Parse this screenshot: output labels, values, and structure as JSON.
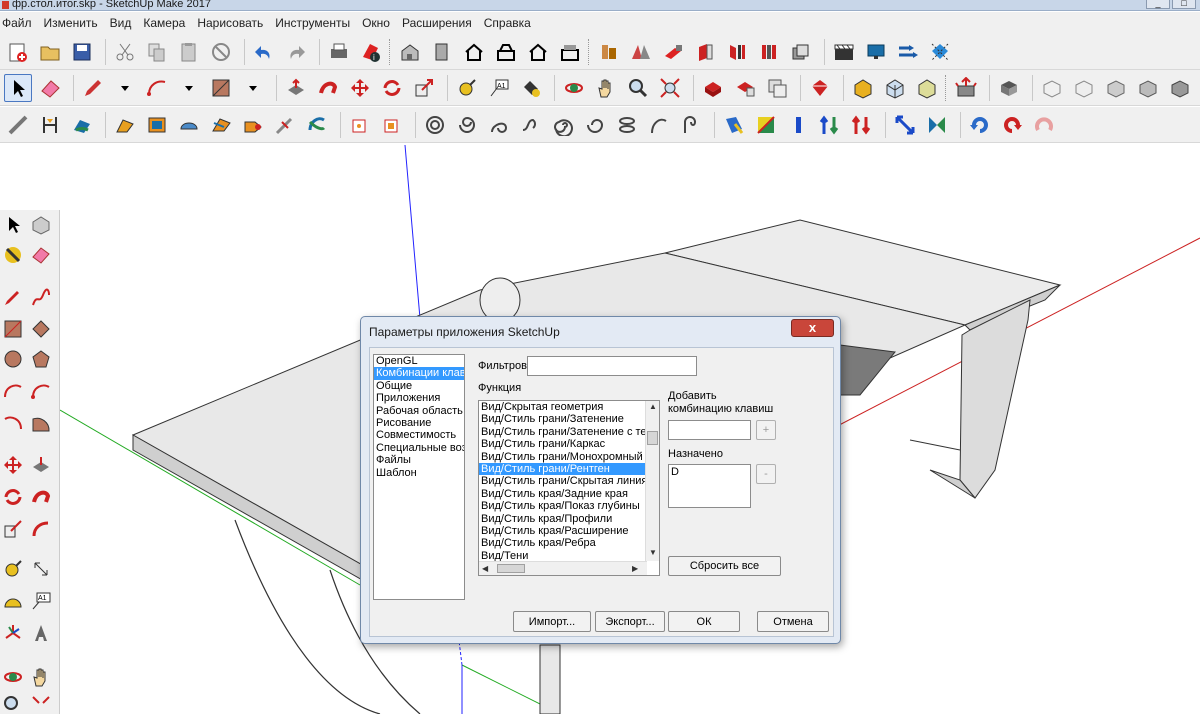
{
  "window": {
    "title": "фр.стол.итог.skp - SketchUp Make 2017",
    "minimize": "_",
    "maximize": "□"
  },
  "menu": [
    "Файл",
    "Изменить",
    "Вид",
    "Камера",
    "Нарисовать",
    "Инструменты",
    "Окно",
    "Расширения",
    "Справка"
  ],
  "toolbar_icons": {
    "row1": [
      "new-file-icon",
      "open-folder-icon",
      "save-icon",
      "cut-icon",
      "copy-icon",
      "paste-icon",
      "erase-icon",
      "undo-icon",
      "redo-icon",
      "print-icon",
      "model-info-icon",
      "iso-view-icon",
      "top-view-icon",
      "front-view-icon",
      "right-view-icon",
      "back-view-icon",
      "left-view-icon",
      "warehouse-icon",
      "extension-icon",
      "components-icon",
      "layers-icon",
      "outliner-icon",
      "materials-icon",
      "scenes-icon",
      "styles-icon",
      "shadows-icon",
      "fog-icon",
      "match-photo-icon"
    ],
    "row2": [
      "select-icon",
      "eraser-icon",
      "pencil-line-icon",
      "arc-icon",
      "rectangle-icon",
      "push-pull-icon",
      "follow-me-icon",
      "move-icon",
      "rotate-icon",
      "scale-icon",
      "tape-measure-icon",
      "text-icon",
      "paint-bucket-icon",
      "orbit-icon",
      "pan-icon",
      "zoom-icon",
      "zoom-extents-icon",
      "warehouse-icon",
      "extension-warehouse-icon",
      "share-model-icon",
      "ruby-console-icon",
      "solid-union-icon",
      "solid-subtract-icon",
      "solid-trim-icon",
      "sandbox-icon",
      "xray-icon",
      "wireframe-icon",
      "hidden-line-icon",
      "shaded-icon",
      "shaded-texture-icon",
      "monochrome-icon"
    ],
    "row3": [
      "line-icon",
      "dimension-icon",
      "follow-me-icon",
      "soften-icon",
      "sandbox-from-contours-icon",
      "sandbox-grid-icon",
      "stamp-icon",
      "drape-icon",
      "add-detail-icon",
      "flip-edge-icon",
      "section-plane-icon",
      "display-section-icon",
      "spiral-1-icon",
      "spiral-2-icon",
      "spiral-3-icon",
      "spiral-4-icon",
      "spiral-5-icon",
      "spiral-6-icon",
      "spiral-7-icon",
      "spiral-8-icon",
      "spiral-9-icon",
      "align-view-icon",
      "align-axes-icon",
      "flip-along-icon",
      "flip-red-icon",
      "flip-green-icon",
      "flip-blue-icon",
      "rotate-cw-icon",
      "rotate-ccw-icon",
      "reset-icon"
    ]
  },
  "dialog": {
    "title": "Параметры приложения SketchUp",
    "close_label": "x",
    "categories": [
      "OpenGL",
      "Комбинации клавиш",
      "Общие",
      "Приложения",
      "Рабочая область",
      "Рисование",
      "Совместимость",
      "Специальные возможности",
      "Файлы",
      "Шаблон"
    ],
    "selected_category_index": 1,
    "filter_label": "Фильтров",
    "filter_value": "",
    "function_label": "Функция",
    "functions": [
      "Вид/Скрытая геометрия",
      "Вид/Стиль грани/Затенение",
      "Вид/Стиль грани/Затенение с текстурами",
      "Вид/Стиль грани/Каркас",
      "Вид/Стиль грани/Монохромный",
      "Вид/Стиль грани/Рентген",
      "Вид/Стиль грани/Скрытая линия",
      "Вид/Стиль края/Задние края",
      "Вид/Стиль края/Показ глубины",
      "Вид/Стиль края/Профили",
      "Вид/Стиль края/Расширение",
      "Вид/Стиль края/Ребра",
      "Вид/Тени"
    ],
    "selected_function_index": 5,
    "add_shortcut_label": "Добавить комбинацию клавиш",
    "add_shortcut_value": "",
    "add_button": "+",
    "assigned_label": "Назначено",
    "assigned_value": "D",
    "remove_button": "-",
    "reset_all": "Сбросить все",
    "import": "Импорт...",
    "export": "Экспорт...",
    "ok": "ОК",
    "cancel": "Отмена"
  }
}
